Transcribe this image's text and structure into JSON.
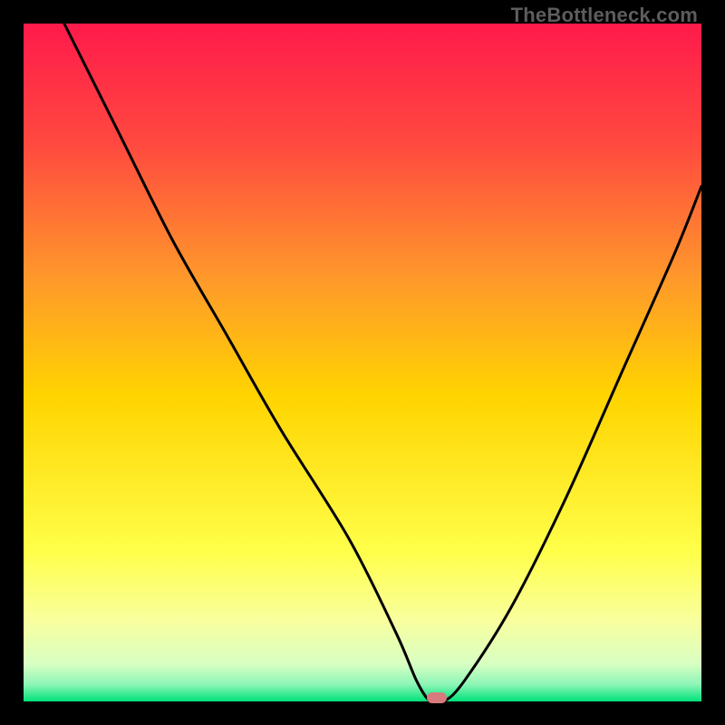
{
  "watermark": "TheBottleneck.com",
  "colors": {
    "bg": "#000000",
    "gradient_top": "#ff1a4b",
    "gradient_mid1": "#ff6a3a",
    "gradient_mid2": "#ffd400",
    "gradient_low1": "#ffff7a",
    "gradient_low2": "#f4ffb0",
    "gradient_bottom": "#00e27a",
    "curve": "#000000",
    "marker": "#d77b7d",
    "watermark": "#5d5d5d"
  },
  "chart_data": {
    "type": "line",
    "title": "",
    "xlabel": "",
    "ylabel": "",
    "xlim": [
      0,
      100
    ],
    "ylim": [
      0,
      100
    ],
    "x": [
      6,
      14,
      22,
      30,
      38,
      48,
      55,
      58,
      60,
      62,
      65,
      72,
      80,
      88,
      96,
      100
    ],
    "values": [
      100,
      84,
      68,
      54,
      40,
      24,
      10,
      3,
      0,
      0,
      3,
      14,
      30,
      48,
      66,
      76
    ],
    "minimum_plateau_x": [
      58,
      64
    ],
    "marker": {
      "x": 61,
      "y": 0
    },
    "gradient_stops": [
      {
        "offset": 0.0,
        "color": "#ff1a4b"
      },
      {
        "offset": 0.18,
        "color": "#ff4a3f"
      },
      {
        "offset": 0.38,
        "color": "#ff9a2a"
      },
      {
        "offset": 0.55,
        "color": "#ffd400"
      },
      {
        "offset": 0.78,
        "color": "#ffff4a"
      },
      {
        "offset": 0.88,
        "color": "#f9ff9e"
      },
      {
        "offset": 0.945,
        "color": "#d8ffc3"
      },
      {
        "offset": 0.975,
        "color": "#8cf5b6"
      },
      {
        "offset": 1.0,
        "color": "#00e27a"
      }
    ]
  }
}
